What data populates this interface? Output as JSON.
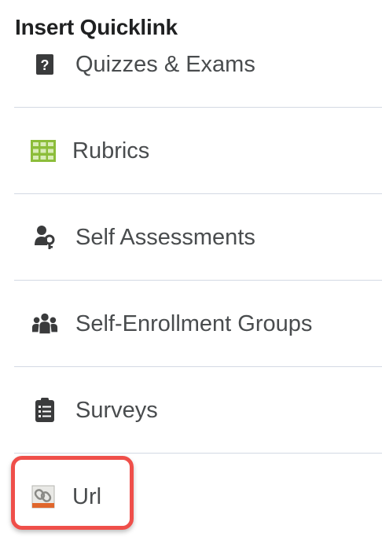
{
  "dialog": {
    "title": "Insert Quicklink"
  },
  "items": [
    {
      "label": "Quizzes & Exams",
      "icon": "quiz-icon"
    },
    {
      "label": "Rubrics",
      "icon": "rubric-grid-icon"
    },
    {
      "label": "Self Assessments",
      "icon": "self-assessment-icon"
    },
    {
      "label": "Self-Enrollment Groups",
      "icon": "groups-icon"
    },
    {
      "label": "Surveys",
      "icon": "clipboard-list-icon"
    },
    {
      "label": "Url",
      "icon": "url-link-icon"
    }
  ],
  "colors": {
    "text": "#494c4e",
    "title": "#202122",
    "divider": "#d3d9e3",
    "highlight": "#ef4f4a",
    "rubric_green": "#8cbd3a",
    "icon_dark": "#3a3b3c"
  }
}
